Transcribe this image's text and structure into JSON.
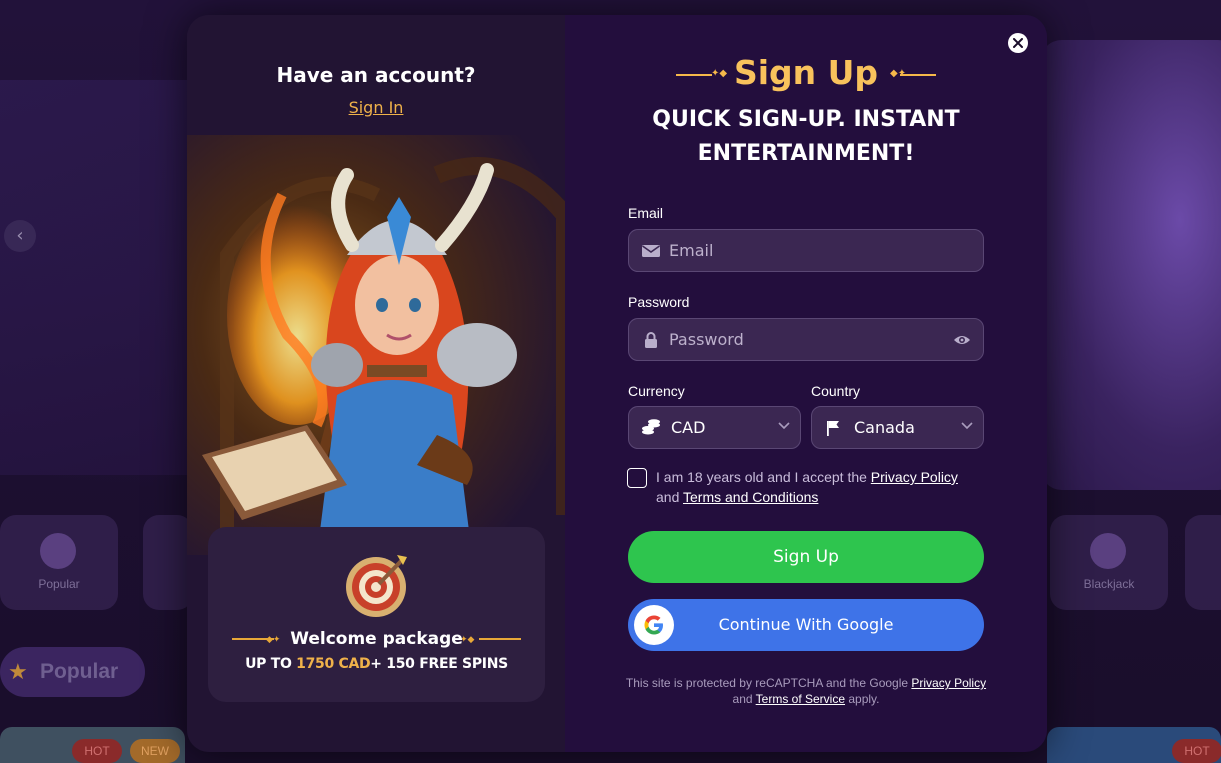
{
  "background": {
    "categories": [
      {
        "label": "Popular"
      },
      {
        "label": "Blackjack"
      }
    ],
    "section_title": "Popular",
    "hot_badge": "HOT",
    "new_badge": "NEW"
  },
  "left_panel": {
    "have_account": "Have an account?",
    "sign_in_link": "Sign In",
    "promo": {
      "title": "Welcome package",
      "sub_prefix": "UP TO ",
      "sub_amount": "1750 CAD",
      "sub_suffix": "+ 150 FREE SPINS"
    }
  },
  "form": {
    "title": "Sign Up",
    "tagline": "QUICK SIGN-UP. INSTANT ENTERTAINMENT!",
    "email": {
      "label": "Email",
      "placeholder": "Email"
    },
    "password": {
      "label": "Password",
      "placeholder": "Password"
    },
    "currency": {
      "label": "Currency",
      "value": "CAD"
    },
    "country": {
      "label": "Country",
      "value": "Canada"
    },
    "agree": {
      "text_1": "I am 18 years old and I accept the ",
      "privacy_link": "Privacy Policy",
      "text_2": " and ",
      "terms_link": "Terms and Conditions"
    },
    "signup_button": "Sign Up",
    "google_button": "Continue With Google",
    "recaptcha": {
      "text_1": "This site is protected by reCAPTCHA and the Google ",
      "privacy_link": "Privacy Policy",
      "text_2": " and ",
      "terms_link": "Terms of Service",
      "text_3": " apply."
    }
  },
  "colors": {
    "accent_gold": "#f8c25c",
    "signup_green": "#2ec54e",
    "google_blue": "#3e73e8",
    "panel_purple": "#230e3d"
  }
}
